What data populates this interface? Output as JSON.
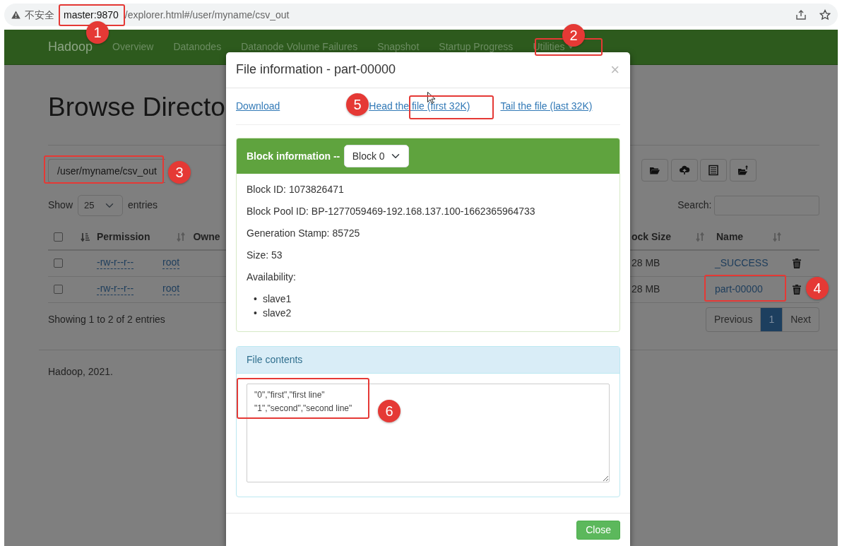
{
  "browser": {
    "security_label": "不安全",
    "host": "master:9870",
    "path": "/explorer.html#/user/myname/csv_out"
  },
  "navbar": {
    "brand": "Hadoop",
    "items": [
      {
        "label": "Overview",
        "dropdown": false
      },
      {
        "label": "Datanodes",
        "dropdown": false
      },
      {
        "label": "Datanode Volume Failures",
        "dropdown": false
      },
      {
        "label": "Snapshot",
        "dropdown": false
      },
      {
        "label": "Startup Progress",
        "dropdown": false
      },
      {
        "label": "Utilities",
        "dropdown": true
      }
    ]
  },
  "page": {
    "heading": "Browse Directo",
    "path": "/user/myname/csv_out",
    "show_label": "Show",
    "page_size": "25",
    "entries_label": "entries",
    "search_label": "Search:",
    "select_all_checked": false,
    "columns_left": [
      "Permission",
      "Owne"
    ],
    "columns_right": [
      "ock Size",
      "Name"
    ],
    "rows": [
      {
        "checked": false,
        "permission": "-rw-r--r--",
        "owner": "root",
        "block_size": "28 MB",
        "name": "_SUCCESS"
      },
      {
        "checked": false,
        "permission": "-rw-r--r--",
        "owner": "root",
        "block_size": "28 MB",
        "name": "part-00000"
      }
    ],
    "summary": "Showing 1 to 2 of 2 entries",
    "pagination": [
      {
        "label": "Previous",
        "selected": false
      },
      {
        "label": "1",
        "selected": true
      },
      {
        "label": "Next",
        "selected": false
      }
    ],
    "footer": "Hadoop, 2021."
  },
  "modal": {
    "title": "File information - part-00000",
    "close_glyph": "×",
    "links": [
      "Download",
      "Head the file (first 32K)",
      "Tail the file (last 32K)"
    ],
    "block_panel": {
      "title": "Block information --",
      "block_select": "Block 0",
      "fields": [
        "Block ID: 1073826471",
        "Block Pool ID: BP-1277059469-192.168.137.100-1662365964733",
        "Generation Stamp: 85725",
        "Size: 53"
      ],
      "availability_label": "Availability:",
      "bullet": "•",
      "hosts": [
        "slave1",
        "slave2"
      ]
    },
    "contents_panel": {
      "title": "File contents",
      "lines": [
        "\"0\",\"first\",\"first line\"",
        "\"1\",\"second\",\"second line\""
      ]
    },
    "close_button": "Close"
  },
  "annotations": [
    {
      "label": "1"
    },
    {
      "label": "2"
    },
    {
      "label": "3"
    },
    {
      "label": "4"
    },
    {
      "label": "5"
    },
    {
      "label": "6"
    }
  ]
}
